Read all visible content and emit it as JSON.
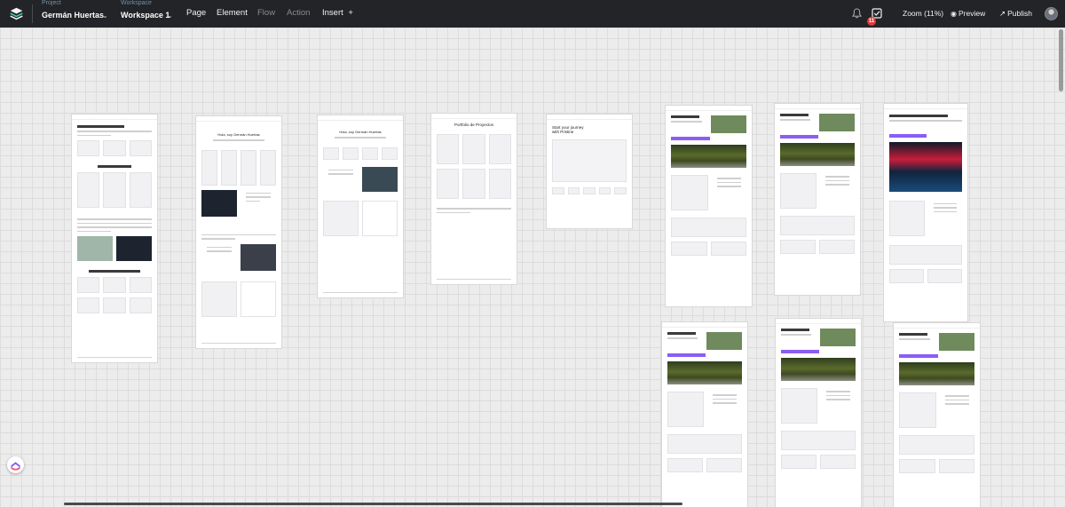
{
  "topbar": {
    "project": {
      "caption": "Project",
      "value": "Germán Huertas"
    },
    "workspace": {
      "caption": "Workspace",
      "value": "Workspace 1"
    },
    "nav": {
      "page": "Page",
      "element": "Element",
      "flow": "Flow",
      "action": "Action",
      "insert": "Insert"
    },
    "notifications_count": "11",
    "zoom": "Zoom (11%)",
    "preview": "Preview",
    "publish": "Publish",
    "colors": {
      "bar": "#232427",
      "caption": "#6e93a8",
      "badge": "#e23a3a",
      "accent": "#8b5cf6"
    }
  },
  "icons": [
    "layers-logo-icon",
    "chevron-down-icon",
    "plus-icon",
    "bell-icon",
    "checkbox-icon",
    "eye-icon",
    "arrow-up-right-icon",
    "avatar",
    "clickup-icon"
  ],
  "canvas": {
    "board_headings": [
      {
        "id": "b1",
        "text": ""
      },
      {
        "id": "b2",
        "text": "Hola, soy Germán Huertas"
      },
      {
        "id": "b3",
        "text": "Hola, soy Germán Huertas"
      },
      {
        "id": "b4",
        "text": "Portfolio de Proyectos"
      },
      {
        "id": "b5",
        "text": "Start your journey with Pristine"
      }
    ]
  }
}
